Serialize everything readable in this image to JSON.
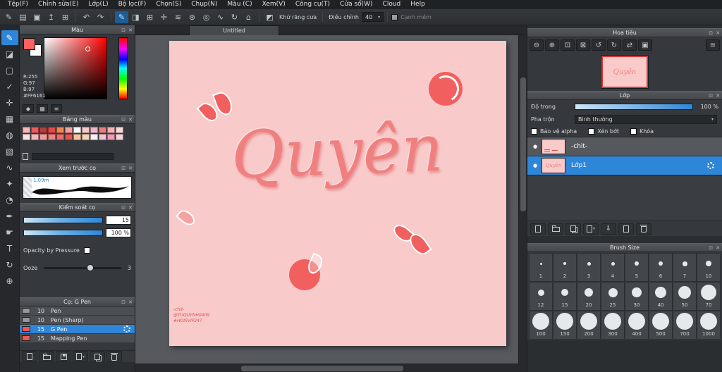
{
  "chrome": {
    "float_glyph": "⊡",
    "close_glyph": "✕",
    "caret": "▾",
    "eye_glyph": "●",
    "accent": "#2f86d8"
  },
  "menubar": {
    "items": [
      "Tệp(F)",
      "Chỉnh sửa(E)",
      "Lớp(L)",
      "Bộ lọc(F)",
      "Chọn(S)",
      "Chụp(N)",
      "Màu (C)",
      "Xem(V)",
      "Công cụ(T)",
      "Cửa sổ(W)",
      "Cloud",
      "Help"
    ]
  },
  "toolbar": {
    "file_icons": [
      {
        "name": "select-cursor-icon",
        "glyph": "✎"
      },
      {
        "name": "clipboard-icon",
        "glyph": "▤"
      },
      {
        "name": "save-icon",
        "glyph": "▣"
      },
      {
        "name": "export-icon",
        "glyph": "↥"
      },
      {
        "name": "canvas-grid-icon",
        "glyph": "⊞"
      }
    ],
    "undo_icons": [
      {
        "name": "undo-icon",
        "glyph": "↶"
      },
      {
        "name": "redo-icon",
        "glyph": "↷"
      }
    ],
    "snap_icons": [
      {
        "name": "brush-mode-icon",
        "glyph": "✎",
        "active": true
      },
      {
        "name": "eraser-mode-icon",
        "glyph": "◨"
      },
      {
        "name": "snap-grid-icon",
        "glyph": "⊞"
      },
      {
        "name": "snap-cross-icon",
        "glyph": "✛"
      },
      {
        "name": "snap-parallel-icon",
        "glyph": "≋"
      },
      {
        "name": "snap-radial-icon",
        "glyph": "⊛"
      },
      {
        "name": "snap-circle-icon",
        "glyph": "◎"
      },
      {
        "name": "snap-curve-icon",
        "glyph": "∿"
      },
      {
        "name": "rotate-view-icon",
        "glyph": "↻"
      },
      {
        "name": "snap-settings-icon",
        "glyph": "⌂"
      }
    ],
    "antialias_icon": "◩",
    "antialias_label": "Khử răng cưa",
    "adjust_label": "Điều chỉnh",
    "adjust_value": "40",
    "soft_edge_label": "Cạnh mềm"
  },
  "toolstrip": {
    "tools": [
      {
        "name": "brush-tool",
        "glyph": "✎",
        "active": true
      },
      {
        "name": "eraser-tool",
        "glyph": "◪"
      },
      {
        "name": "rectangle-tool",
        "glyph": "▢"
      },
      {
        "name": "dot-pen-tool",
        "glyph": "✓"
      },
      {
        "name": "move-tool",
        "glyph": "✛"
      },
      {
        "name": "select-tool",
        "glyph": "▦"
      },
      {
        "name": "bucket-tool",
        "glyph": "◍"
      },
      {
        "name": "gradient-tool",
        "glyph": "▧"
      },
      {
        "name": "lasso-tool",
        "glyph": "∿"
      },
      {
        "name": "magic-wand-tool",
        "glyph": "✦"
      },
      {
        "name": "eyedropper-tool",
        "glyph": "◔"
      },
      {
        "name": "pen-tool",
        "glyph": "✒"
      },
      {
        "name": "hand-tool",
        "glyph": "☛"
      },
      {
        "name": "text-tool",
        "glyph": "T"
      },
      {
        "name": "rotate-tool",
        "glyph": "↻"
      },
      {
        "name": "zoom-tool",
        "glyph": "⊕"
      }
    ]
  },
  "color_panel": {
    "title": "Màu",
    "foreground": "#FF6161",
    "rgb_lines": [
      "R:255",
      "G:97",
      "B:97",
      "#FF6161"
    ],
    "footer_icons": [
      {
        "name": "eyedropper-small-icon",
        "glyph": "◆"
      },
      {
        "name": "swatches-small-icon",
        "glyph": "▦"
      },
      {
        "name": "color-menu-icon",
        "glyph": "≡"
      }
    ]
  },
  "palette_panel": {
    "title": "Bảng màu",
    "swatches": [
      "#f6b7b7",
      "#ee5a5a",
      "#b04040",
      "#e84848",
      "#ef8850",
      "#f2a0a0",
      "#ffffff",
      "#f6caca",
      "#efb6c8",
      "#e87f7f",
      "#f3b3b3",
      "#f9d9d9",
      "#fbe3e3",
      "#f3b9b9",
      "#ef9d9d",
      "#ea8585",
      "#e86c6c",
      "#e45454",
      "#f2c6a5",
      "#efd9b5",
      "#fdf2f2",
      "#f2c3d3",
      "#ee9db5",
      "#f6d3dd"
    ]
  },
  "preview_panel": {
    "title": "Xem trước cọ",
    "size_label": "1.09m"
  },
  "control_panel": {
    "title": "Kiểm soát cọ",
    "size_value": "15",
    "opacity_value": "100 %",
    "pressure_label": "Opacity by Pressure",
    "ooze_label": "Ooze",
    "ooze_value": "3"
  },
  "brush_panel": {
    "title": "Cọ: G Pen",
    "brushes": [
      {
        "size": "10",
        "label": "Pen",
        "swatch": "#94979a",
        "selected": false
      },
      {
        "size": "10",
        "label": "Pen (Sharp)",
        "swatch": "#94979a",
        "selected": false
      },
      {
        "size": "15",
        "label": "G Pen",
        "swatch": "#f25555",
        "selected": true
      },
      {
        "size": "15",
        "label": "Mapping Pen",
        "swatch": "#f25555",
        "selected": false
      }
    ]
  },
  "brush_toolbar": [
    {
      "name": "add-brush-icon",
      "kind": "page"
    },
    {
      "name": "brush-folder-icon",
      "kind": "folder"
    },
    {
      "name": "save-brush-icon",
      "kind": "save"
    },
    {
      "name": "brush-menu-icon",
      "kind": "page-caret"
    },
    {
      "name": "duplicate-brush-icon",
      "kind": "copy"
    },
    {
      "name": "delete-brush-icon",
      "kind": "trash"
    }
  ],
  "canvas": {
    "tab": "Untitled",
    "word": "Quyên",
    "background": "#f9caca",
    "ink": "#f08080",
    "signature": [
      "-chit-",
      "@TUQUYNH0409",
      "#HOISVIP247"
    ]
  },
  "navigator": {
    "title": "Hoa tiêu",
    "buttons": [
      {
        "name": "zoom-out-icon",
        "glyph": "⊖"
      },
      {
        "name": "zoom-in-icon",
        "glyph": "⊕"
      },
      {
        "name": "fit-window-icon",
        "glyph": "⊡"
      },
      {
        "name": "actual-size-icon",
        "glyph": "⊠"
      },
      {
        "name": "rotate-ccw-icon",
        "glyph": "↺"
      },
      {
        "name": "rotate-cw-icon",
        "glyph": "↻"
      },
      {
        "name": "flip-horizontal-icon",
        "glyph": "⇄"
      },
      {
        "name": "reset-view-icon",
        "glyph": "▣"
      }
    ],
    "menu_button": {
      "name": "navigator-menu-icon",
      "glyph": "≡"
    }
  },
  "layer_panel": {
    "title": "Lớp",
    "opacity_label": "Độ trong",
    "opacity_value": "100 %",
    "blend_label": "Pha trộn",
    "blend_value": "Bình thường",
    "options": [
      "Bảo vệ alpha",
      "Xén bớt",
      "Khóa"
    ],
    "layers": [
      {
        "name": "-chit-",
        "selected": false
      },
      {
        "name": "Lớp1",
        "selected": true
      }
    ],
    "toolbar": [
      {
        "name": "add-layer-icon",
        "kind": "page"
      },
      {
        "name": "add-folder-icon",
        "kind": "folder"
      },
      {
        "name": "duplicate-layer-icon",
        "kind": "copy"
      },
      {
        "name": "layer-menu-icon",
        "kind": "page-caret"
      },
      {
        "name": "merge-down-icon",
        "kind": "merge"
      },
      {
        "name": "transfer-layer-icon",
        "kind": "page"
      },
      {
        "name": "delete-layer-icon",
        "kind": "trash"
      }
    ]
  },
  "brush_size_panel": {
    "title": "Brush Size",
    "sizes": [
      1,
      2,
      3,
      4,
      5,
      6,
      7,
      10,
      12,
      15,
      20,
      25,
      30,
      40,
      50,
      70,
      100,
      150,
      200,
      300,
      400,
      500,
      700,
      1000
    ]
  }
}
